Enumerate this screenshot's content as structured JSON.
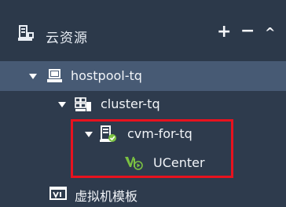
{
  "header": {
    "title": "云资源",
    "add_label": "+",
    "remove_label": "−",
    "collapse_label": "^"
  },
  "tree": [
    {
      "label": "hostpool-tq",
      "expanded": true,
      "selected": true,
      "icon": "host-pool-icon"
    },
    {
      "label": "cluster-tq",
      "expanded": true,
      "selected": false,
      "icon": "cluster-icon"
    },
    {
      "label": "cvm-for-tq",
      "expanded": true,
      "selected": false,
      "icon": "cvm-host-icon"
    },
    {
      "label": "UCenter",
      "expanded": false,
      "selected": false,
      "icon": "vm-running-icon"
    },
    {
      "label": "虚拟机模板",
      "expanded": false,
      "selected": false,
      "icon": "vm-template-icon"
    }
  ],
  "colors": {
    "background": "#2e3b4d",
    "selected_row": "#475a74",
    "highlight_border": "#e8121e",
    "running_green": "#7bc142"
  }
}
